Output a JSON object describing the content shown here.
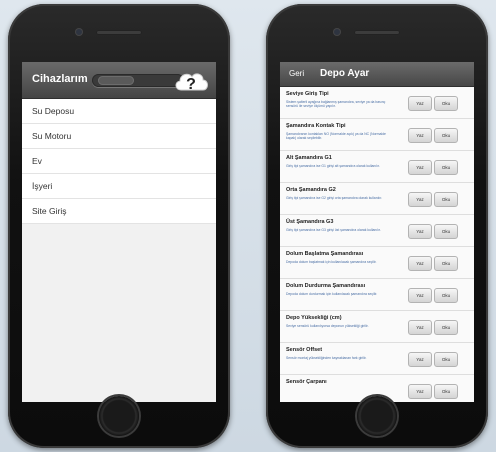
{
  "left_app": {
    "title": "Cihazlarım",
    "menu": [
      {
        "label": "Su Deposu"
      },
      {
        "label": "Su Motoru"
      },
      {
        "label": "Ev"
      },
      {
        "label": "İşyeri"
      },
      {
        "label": "Site Giriş"
      }
    ]
  },
  "right_app": {
    "back_label": "Geri",
    "title": "Depo Ayar",
    "write_label": "Yaz",
    "read_label": "Oku",
    "settings": [
      {
        "title": "Seviye Giriş Tipi",
        "desc": "Sistem şalterli ayağına bağlanmış şamandıra, seviye ya da basınç sensörü ile seviye ölçümü yapılır."
      },
      {
        "title": "Şamandıra Kontak Tipi",
        "desc": "Şamandıranın kontakları NO (Normalde açık) ya da NC (Normalde kapalı) olarak seçilebilir."
      },
      {
        "title": "Alt Şamandıra G1",
        "desc": "Giriş tipi şamandıra ise G1 girişi alt şamandıra olarak kullanılır."
      },
      {
        "title": "Orta Şamandıra G2",
        "desc": "Giriş tipi şamandıra ise G2 girişi orta şamandıra olarak kullanılır."
      },
      {
        "title": "Üst Şamandıra G3",
        "desc": "Giriş tipi şamandıra ise G3 girişi üst şamandıra olarak kullanılır."
      },
      {
        "title": "Dolum Başlatma Şamandırası",
        "desc": "Depoda dolum başlatmak için kullanılacak şamandıra seçilir."
      },
      {
        "title": "Dolum Durdurma Şamandırası",
        "desc": "Depoda dolum durdurmak için kullanılacak şamandıra seçilir."
      },
      {
        "title": "Depo Yüksekliği (cm)",
        "desc": "Seviye sensörü kullanılıyorsa deponun yüksekliği girilir."
      },
      {
        "title": "Sensör Offset",
        "desc": "Sensör montaj yüksekliğinden kaynaklanan fark girilir."
      },
      {
        "title": "Sensör Çarpanı",
        "desc": ""
      }
    ]
  }
}
